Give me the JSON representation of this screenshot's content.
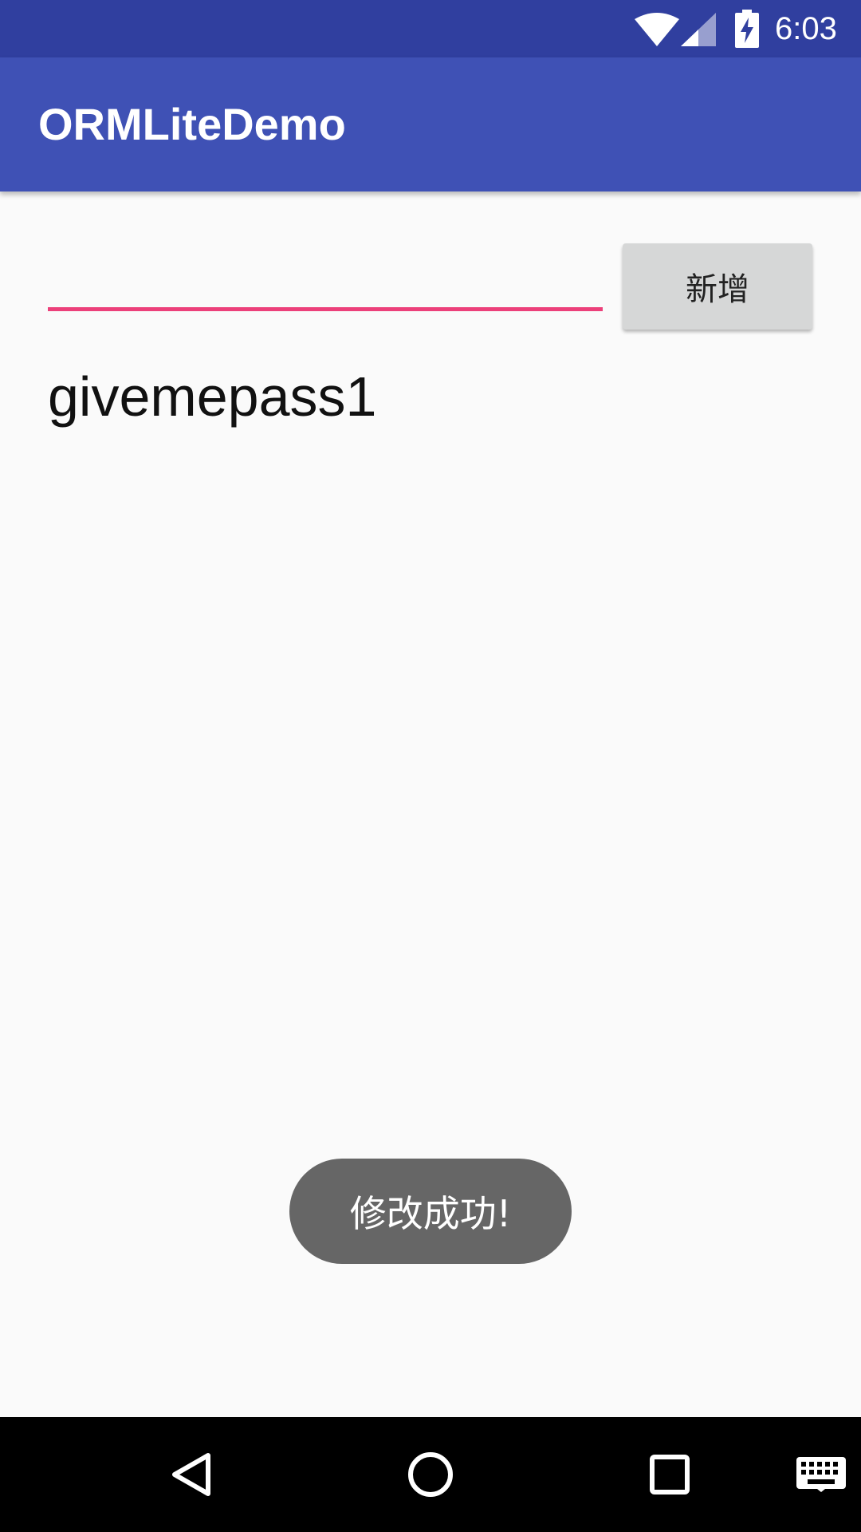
{
  "status_bar": {
    "time": "6:03",
    "icons": [
      "wifi-icon",
      "cellular-signal-icon",
      "battery-charging-icon"
    ],
    "background": "#303F9F"
  },
  "app_bar": {
    "title": "ORMLiteDemo",
    "background": "#3F51B5"
  },
  "form": {
    "input_value": "",
    "input_placeholder": "",
    "underline_color": "#EC407A",
    "add_button_label": "新增"
  },
  "list": {
    "items": [
      {
        "label": "givemepass1"
      }
    ]
  },
  "toast": {
    "message": "修改成功!"
  },
  "nav_bar": {
    "icons": [
      "back-icon",
      "home-icon",
      "recent-apps-icon",
      "keyboard-icon"
    ]
  }
}
